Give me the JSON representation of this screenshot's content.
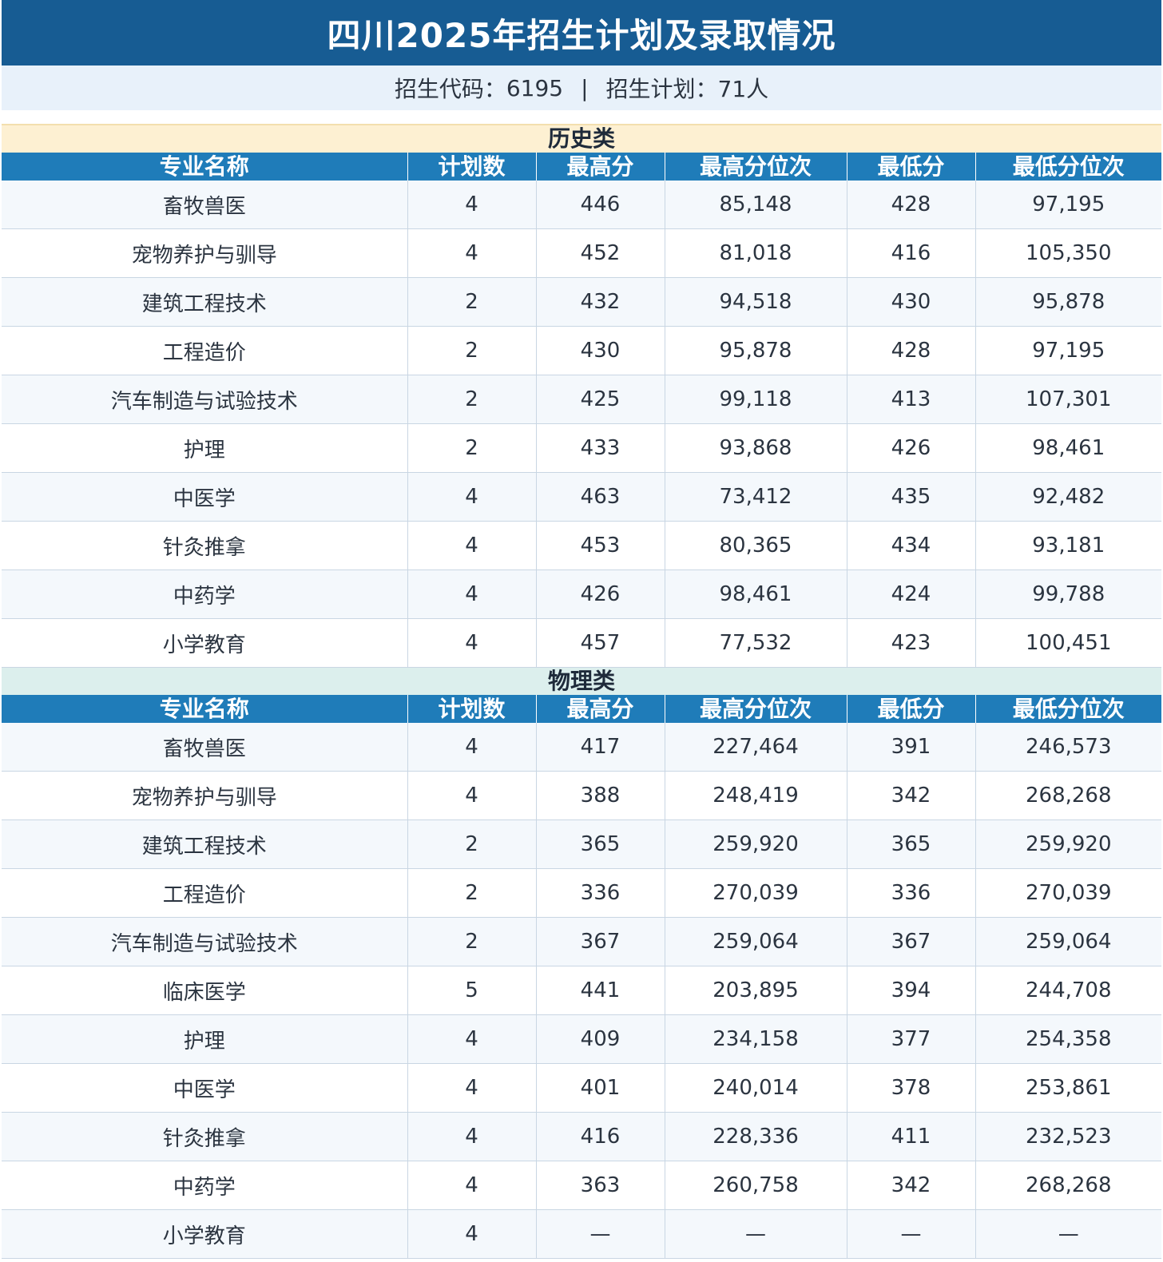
{
  "title": "四川2025年招生计划及录取情况",
  "info": {
    "code_label": "招生代码：",
    "code_value": "6195",
    "separator": "|",
    "plan_label": "招生计划：",
    "plan_value": "71人"
  },
  "columns": [
    "专业名称",
    "计划数",
    "最高分",
    "最高分位次",
    "最低分",
    "最低分位次"
  ],
  "colors": {
    "title_bg": "#175c93",
    "info_bg": "#e8f1fa",
    "header_bg": "#1f7cb9",
    "history_section_bg": "#fdf0d2",
    "physics_section_bg": "#dcefed"
  },
  "sections": [
    {
      "name": "历史类",
      "rows": [
        [
          "畜牧兽医",
          "4",
          "446",
          "85,148",
          "428",
          "97,195"
        ],
        [
          "宠物养护与驯导",
          "4",
          "452",
          "81,018",
          "416",
          "105,350"
        ],
        [
          "建筑工程技术",
          "2",
          "432",
          "94,518",
          "430",
          "95,878"
        ],
        [
          "工程造价",
          "2",
          "430",
          "95,878",
          "428",
          "97,195"
        ],
        [
          "汽车制造与试验技术",
          "2",
          "425",
          "99,118",
          "413",
          "107,301"
        ],
        [
          "护理",
          "2",
          "433",
          "93,868",
          "426",
          "98,461"
        ],
        [
          "中医学",
          "4",
          "463",
          "73,412",
          "435",
          "92,482"
        ],
        [
          "针灸推拿",
          "4",
          "453",
          "80,365",
          "434",
          "93,181"
        ],
        [
          "中药学",
          "4",
          "426",
          "98,461",
          "424",
          "99,788"
        ],
        [
          "小学教育",
          "4",
          "457",
          "77,532",
          "423",
          "100,451"
        ]
      ]
    },
    {
      "name": "物理类",
      "rows": [
        [
          "畜牧兽医",
          "4",
          "417",
          "227,464",
          "391",
          "246,573"
        ],
        [
          "宠物养护与驯导",
          "4",
          "388",
          "248,419",
          "342",
          "268,268"
        ],
        [
          "建筑工程技术",
          "2",
          "365",
          "259,920",
          "365",
          "259,920"
        ],
        [
          "工程造价",
          "2",
          "336",
          "270,039",
          "336",
          "270,039"
        ],
        [
          "汽车制造与试验技术",
          "2",
          "367",
          "259,064",
          "367",
          "259,064"
        ],
        [
          "临床医学",
          "5",
          "441",
          "203,895",
          "394",
          "244,708"
        ],
        [
          "护理",
          "4",
          "409",
          "234,158",
          "377",
          "254,358"
        ],
        [
          "中医学",
          "4",
          "401",
          "240,014",
          "378",
          "253,861"
        ],
        [
          "针灸推拿",
          "4",
          "416",
          "228,336",
          "411",
          "232,523"
        ],
        [
          "中药学",
          "4",
          "363",
          "260,758",
          "342",
          "268,268"
        ],
        [
          "小学教育",
          "4",
          "—",
          "—",
          "—",
          "—"
        ]
      ]
    }
  ]
}
